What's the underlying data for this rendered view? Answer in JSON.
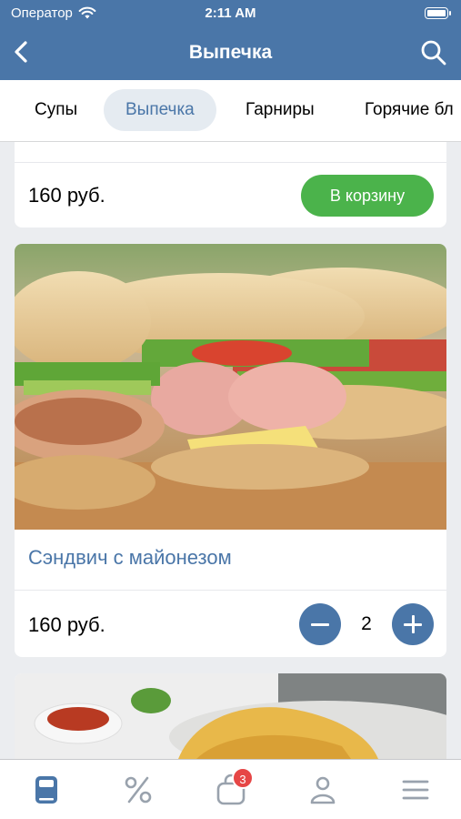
{
  "status_bar": {
    "carrier": "Оператор",
    "time": "2:11 AM"
  },
  "nav": {
    "title": "Выпечка",
    "back_icon": "chevron-left-icon",
    "search_icon": "search-icon"
  },
  "tabs": [
    {
      "label": "Супы",
      "active": false
    },
    {
      "label": "Выпечка",
      "active": true
    },
    {
      "label": "Гарниры",
      "active": false
    },
    {
      "label": "Горячие бл",
      "active": false
    }
  ],
  "prev_card": {
    "price": "160 руб.",
    "add_to_cart_label": "В корзину"
  },
  "product": {
    "title": "Сэндвич с майонезом",
    "price": "160 руб.",
    "quantity": "2"
  },
  "tabbar": {
    "items": [
      {
        "icon": "menu-book-icon",
        "active": true
      },
      {
        "icon": "percent-icon",
        "active": false
      },
      {
        "icon": "shopping-bag-icon",
        "active": false,
        "badge": "3"
      },
      {
        "icon": "profile-icon",
        "active": false
      },
      {
        "icon": "hamburger-menu-icon",
        "active": false
      }
    ]
  },
  "colors": {
    "accent": "#4a76a8",
    "cart_button": "#4bb34b",
    "badge": "#e64646",
    "inactive_icon": "#99a2ad"
  }
}
